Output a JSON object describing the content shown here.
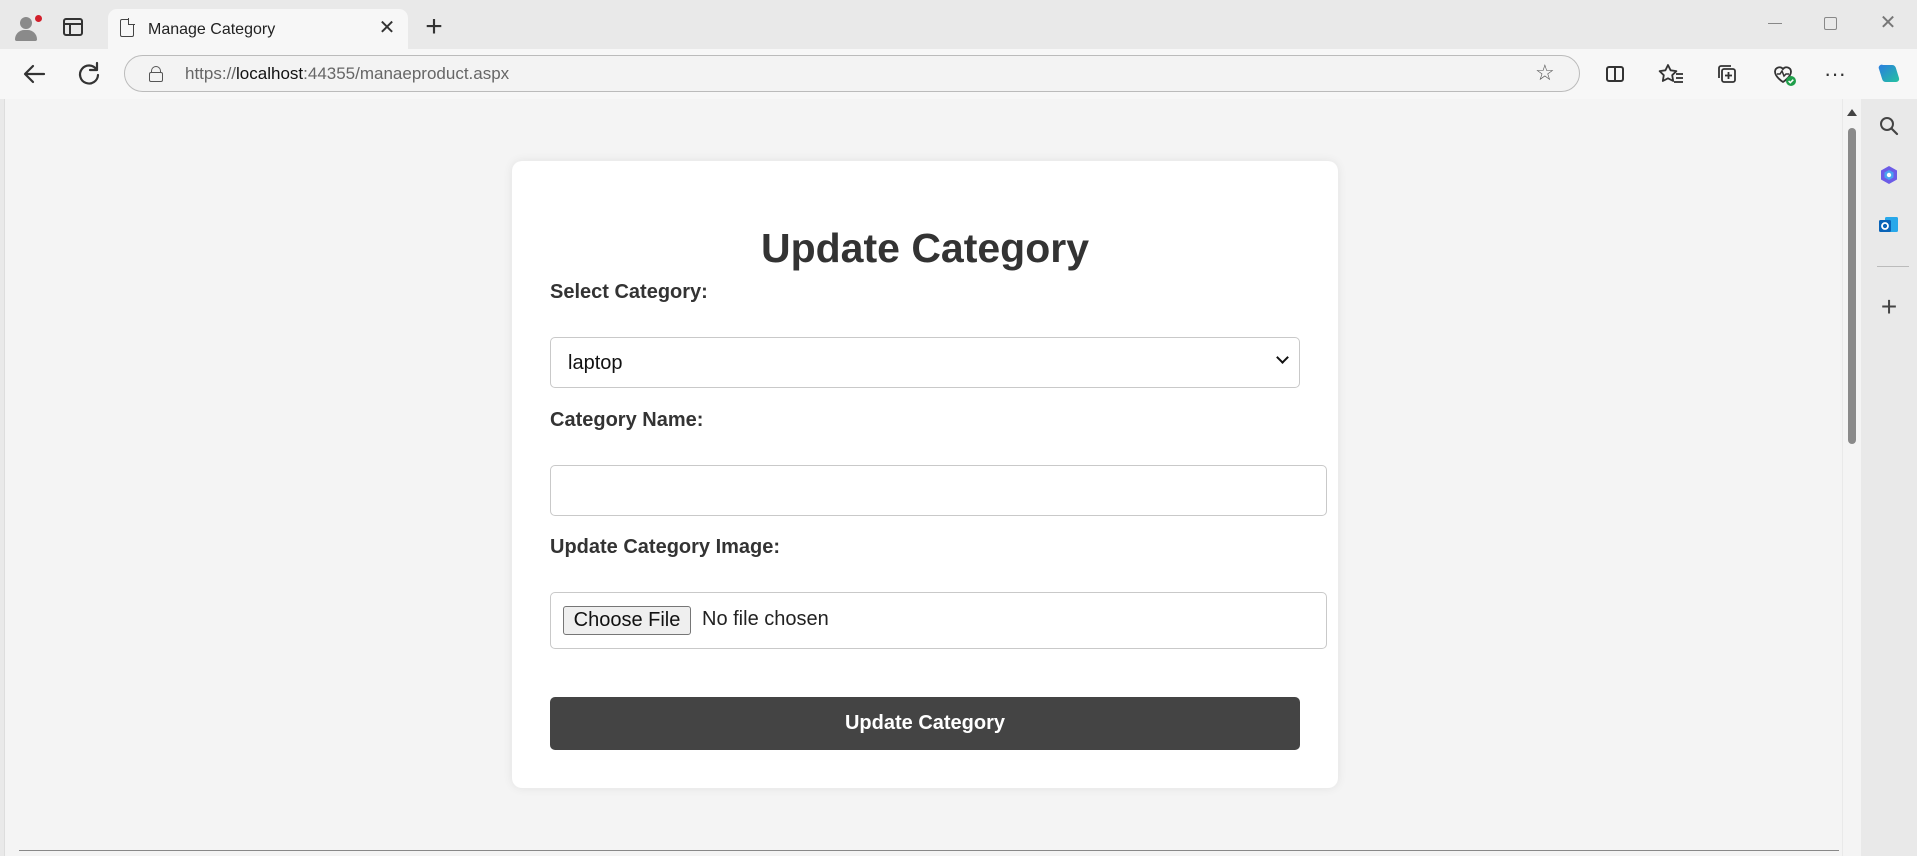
{
  "browser": {
    "tab_title": "Manage Category",
    "url_prefix": "https://",
    "url_host": "localhost",
    "url_path": ":44355/manaeproduct.aspx"
  },
  "form": {
    "title": "Update Category",
    "select_label": "Select Category:",
    "select_value": "laptop",
    "name_label": "Category Name:",
    "name_value": "",
    "image_label": "Update Category Image:",
    "file_button": "Choose File",
    "file_status": "No file chosen",
    "submit_label": "Update Category"
  },
  "colors": {
    "button_bg": "#444444",
    "page_bg": "#f4f4f4",
    "card_bg": "#ffffff"
  }
}
